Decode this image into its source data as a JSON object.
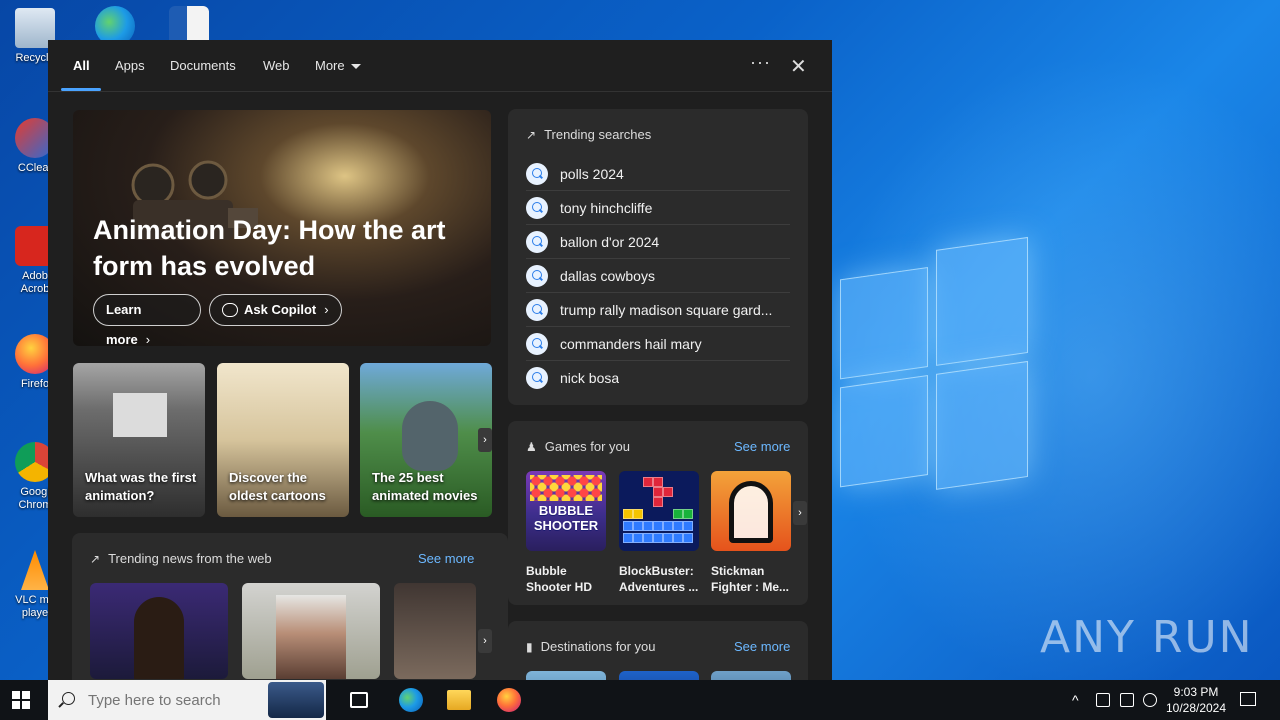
{
  "desktop": {
    "icons": [
      {
        "label": "Recycle"
      },
      {
        "label": "CClear"
      },
      {
        "label": "Adob Acrob"
      },
      {
        "label": "Firefo"
      },
      {
        "label": "Googl Chrom"
      },
      {
        "label": "VLC me playe"
      }
    ],
    "watermark": "ANY RUN"
  },
  "search_panel": {
    "tabs": [
      "All",
      "Apps",
      "Documents",
      "Web",
      "More"
    ],
    "active_tab": "All",
    "more_icon": "ellipsis-icon",
    "close_icon": "close-icon",
    "hero": {
      "title": "Animation Day: How the art form has evolved",
      "learn_more": "Learn more",
      "ask_copilot": "Ask Copilot"
    },
    "cards": [
      {
        "text": "What was the first animation?"
      },
      {
        "text": "Discover the oldest cartoons"
      },
      {
        "text": "The 25 best animated movies"
      }
    ],
    "news": {
      "heading": "Trending news from the web",
      "see_more": "See more"
    },
    "trending": {
      "heading": "Trending searches",
      "items": [
        "polls 2024",
        "tony hinchcliffe",
        "ballon d'or 2024",
        "dallas cowboys",
        "trump rally madison square gard...",
        "commanders hail mary",
        "nick bosa"
      ]
    },
    "games": {
      "heading": "Games for you",
      "see_more": "See more",
      "items": [
        {
          "name": "Bubble Shooter HD",
          "art_text": "BUBBLE SHOOTER"
        },
        {
          "name": "BlockBuster: Adventures ..."
        },
        {
          "name": "Stickman Fighter : Me..."
        }
      ]
    },
    "destinations": {
      "heading": "Destinations for you",
      "see_more": "See more"
    }
  },
  "taskbar": {
    "search_placeholder": "Type here to search",
    "time": "9:03 PM",
    "date": "10/28/2024"
  }
}
